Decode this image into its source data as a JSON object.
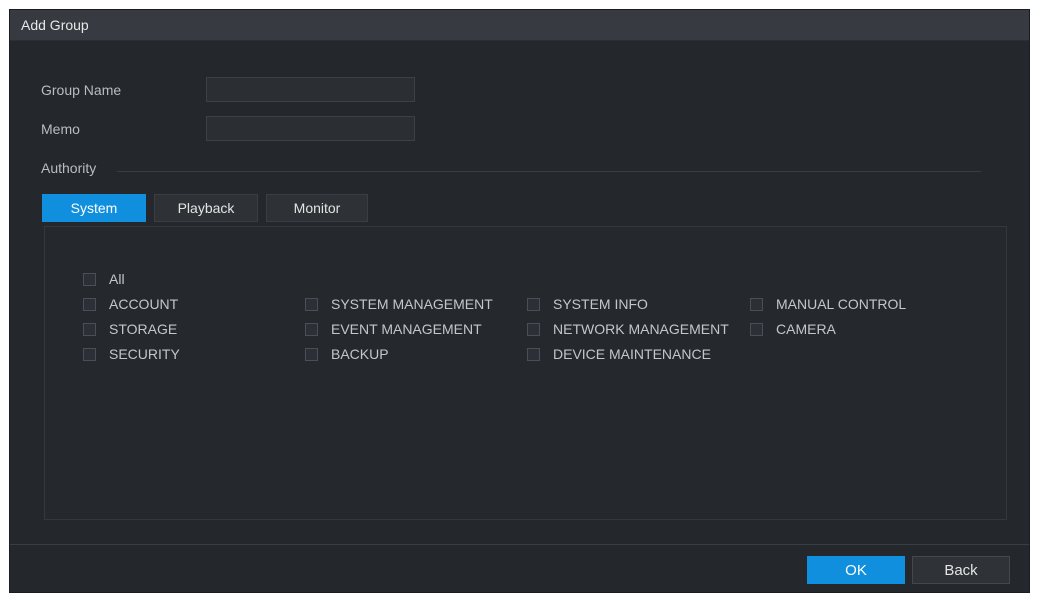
{
  "dialog": {
    "title": "Add Group"
  },
  "form": {
    "group_name_label": "Group Name",
    "group_name_value": "",
    "memo_label": "Memo",
    "memo_value": ""
  },
  "authority": {
    "label": "Authority",
    "tabs": [
      {
        "label": "System",
        "active": true
      },
      {
        "label": "Playback",
        "active": false
      },
      {
        "label": "Monitor",
        "active": false
      }
    ],
    "all_label": "All",
    "permissions": [
      {
        "label": "ACCOUNT",
        "checked": false
      },
      {
        "label": "SYSTEM MANAGEMENT",
        "checked": false
      },
      {
        "label": "SYSTEM INFO",
        "checked": false
      },
      {
        "label": "MANUAL CONTROL",
        "checked": false
      },
      {
        "label": "STORAGE",
        "checked": false
      },
      {
        "label": "EVENT MANAGEMENT",
        "checked": false
      },
      {
        "label": "NETWORK MANAGEMENT",
        "checked": false
      },
      {
        "label": "CAMERA",
        "checked": false
      },
      {
        "label": "SECURITY",
        "checked": false
      },
      {
        "label": "BACKUP",
        "checked": false
      },
      {
        "label": "DEVICE MAINTENANCE",
        "checked": false
      }
    ]
  },
  "footer": {
    "ok_label": "OK",
    "back_label": "Back"
  },
  "colors": {
    "accent": "#0f8fdd",
    "background": "#24272c",
    "titlebar": "#373a40"
  }
}
